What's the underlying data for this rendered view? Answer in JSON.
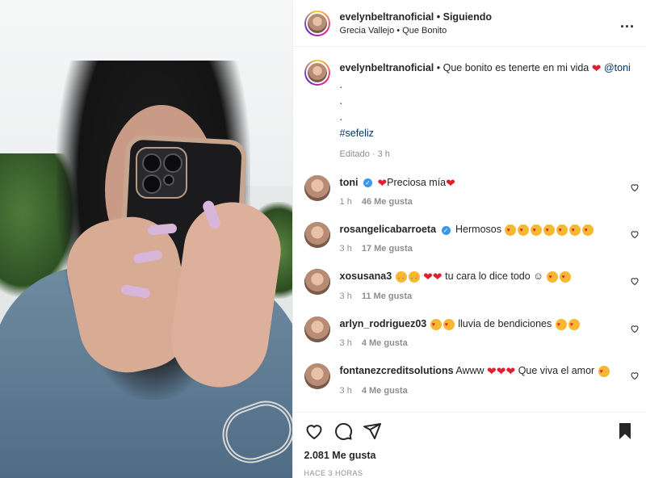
{
  "post": {
    "photo_alt": "woman taking mirror selfie with phone",
    "owner": "evelynbeltranoficial",
    "follow_dot": "•",
    "follow_label": "Siguiendo",
    "audio_line": "Grecia Vallejo • Que Bonito",
    "more_label": "..."
  },
  "caption": {
    "username": "evelynbeltranoficial",
    "text": "• Que bonito es tenerte en mi vida",
    "mention": "@toni",
    "dots": ".",
    "hashtag": "#sefeliz",
    "edited": "Editado · 3 h"
  },
  "comments": [
    {
      "username": "toni",
      "verified": true,
      "text_pre": "",
      "text": "Preciosa mía",
      "time": "1 h",
      "likes": "46 Me gusta"
    },
    {
      "username": "rosangelicabarroeta",
      "verified": true,
      "text": "Hermosos",
      "time": "3 h",
      "likes": "17 Me gusta"
    },
    {
      "username": "xosusana3",
      "verified": false,
      "text": "tu cara lo dice todo ☺",
      "time": "3 h",
      "likes": "11 Me gusta"
    },
    {
      "username": "arlyn_rodriguez03",
      "verified": false,
      "text": "lluvia de bendiciones",
      "time": "3 h",
      "likes": "4 Me gusta"
    },
    {
      "username": "fontanezcreditsolutions",
      "verified": false,
      "text": "Awww",
      "text2": "Que viva el amor",
      "time": "3 h",
      "likes": "4 Me gusta"
    }
  ],
  "footer": {
    "likes": "2.081 Me gusta",
    "time": "HACE 3 HORAS"
  },
  "icons": [
    "heart-icon",
    "comment-icon",
    "share-icon",
    "bookmark-icon",
    "more-icon",
    "verified-icon"
  ],
  "colors": {
    "verified": "#3897f0",
    "heart": "#e0202e",
    "muted": "#8e8e8e",
    "link": "#00376b"
  }
}
